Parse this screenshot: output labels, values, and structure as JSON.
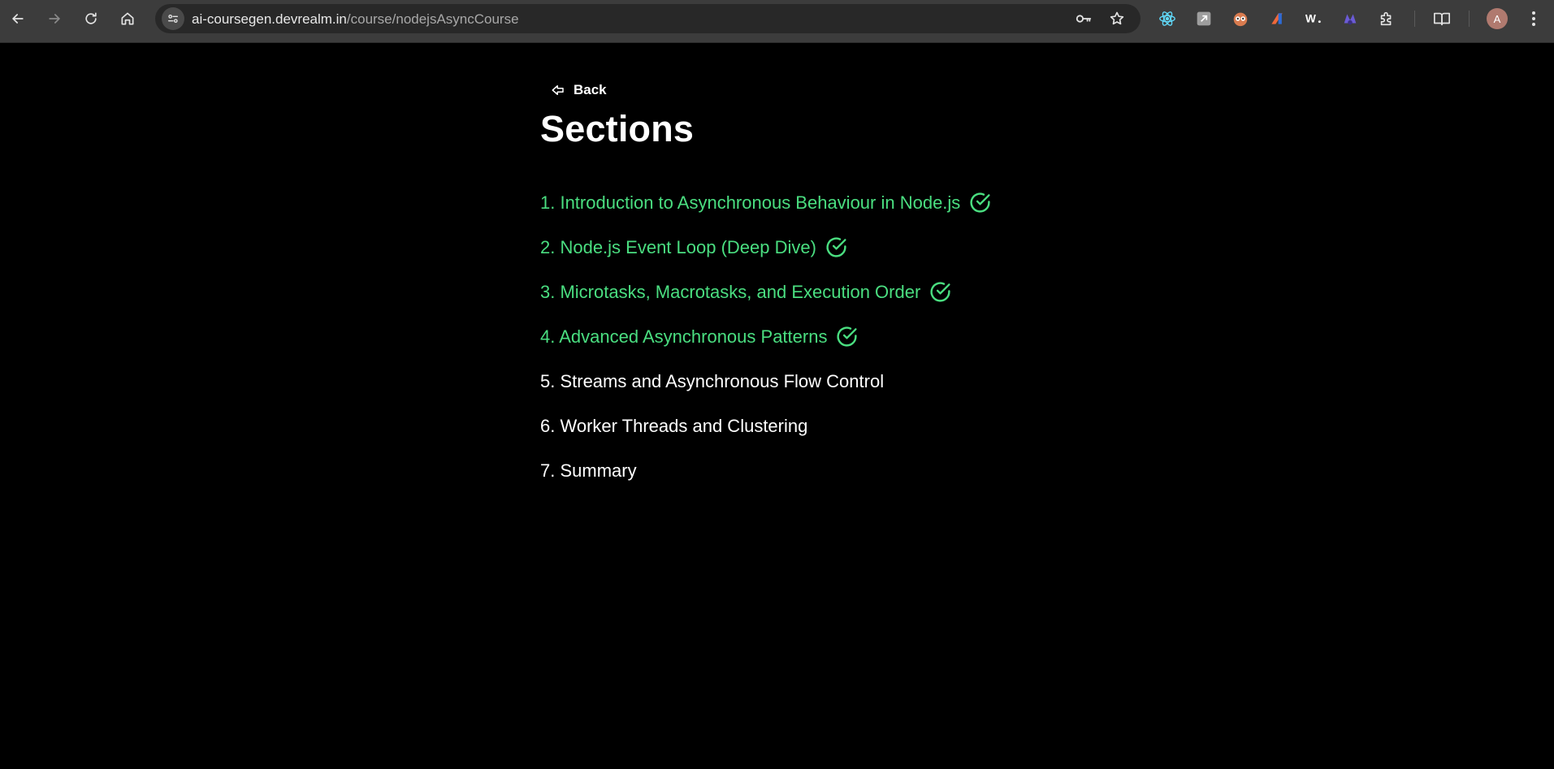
{
  "browser": {
    "url_host": "ai-coursegen.devrealm.in",
    "url_path": "/course/nodejsAsyncCourse",
    "profile_initial": "A",
    "extensions": [
      "react-devtools-icon",
      "extension-icon",
      "extension-icon",
      "extension-icon",
      "extension-icon",
      "extension-icon"
    ]
  },
  "page": {
    "back_label": "Back",
    "title": "Sections",
    "sections": [
      {
        "label": "1. Introduction to Asynchronous Behaviour in Node.js",
        "completed": true
      },
      {
        "label": "2. Node.js Event Loop (Deep Dive)",
        "completed": true
      },
      {
        "label": "3. Microtasks, Macrotasks, and Execution Order",
        "completed": true
      },
      {
        "label": "4. Advanced Asynchronous Patterns",
        "completed": true
      },
      {
        "label": "5. Streams and Asynchronous Flow Control",
        "completed": false
      },
      {
        "label": "6. Worker Threads and Clustering",
        "completed": false
      },
      {
        "label": "7. Summary",
        "completed": false
      }
    ]
  },
  "colors": {
    "completed": "#4ade80",
    "pending": "#ffffff",
    "background": "#000000"
  }
}
